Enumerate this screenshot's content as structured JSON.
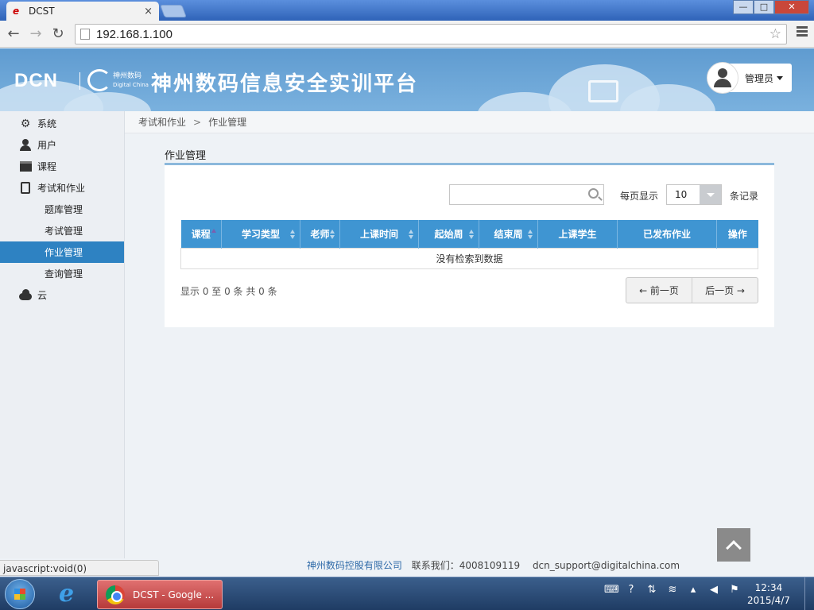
{
  "browser": {
    "tab_title": "DCST",
    "tab_close": "×",
    "url": "192.168.1.100",
    "back": "←",
    "forward": "→",
    "reload": "↻",
    "star": "☆"
  },
  "window_controls": {
    "minimize": "—",
    "maximize": "□",
    "close": "✕"
  },
  "header": {
    "logo_text": "DCN",
    "logo_cn": "神州数码",
    "logo_en": "Digital China",
    "title": "神州数码信息安全实训平台",
    "user_name": "管理员"
  },
  "sidebar": {
    "items": [
      {
        "label": "系统",
        "icon": "gear-icon"
      },
      {
        "label": "用户",
        "icon": "user-icon"
      },
      {
        "label": "课程",
        "icon": "course-icon"
      },
      {
        "label": "考试和作业",
        "icon": "exam-icon"
      },
      {
        "label": "题库管理",
        "sub": true
      },
      {
        "label": "考试管理",
        "sub": true
      },
      {
        "label": "作业管理",
        "sub": true,
        "active": true
      },
      {
        "label": "查询管理",
        "sub": true
      },
      {
        "label": "云",
        "icon": "cloud-icon"
      }
    ]
  },
  "breadcrumb": {
    "parent": "考试和作业",
    "separator": ">",
    "current": "作业管理"
  },
  "panel": {
    "title": "作业管理",
    "search_value": "",
    "per_page_label": "每页显示",
    "per_page_value": "10",
    "records_label": "条记录",
    "columns": [
      "课程",
      "学习类型",
      "老师",
      "上课时间",
      "起始周",
      "结束周",
      "上课学生",
      "已发布作业",
      "操作"
    ],
    "empty_message": "没有检索到数据",
    "info": "显示 0 至 0 条   共 0 条",
    "prev_label": "← 前一页",
    "next_label": "后一页 →"
  },
  "footer": {
    "company": "神州数码控股有限公司",
    "contact": "联系我们：4008109119",
    "email": "dcn_support@digitalchina.com"
  },
  "status_bar": "javascript:void(0)",
  "taskbar": {
    "task_label": "DCST - Google ...",
    "time": "12:34",
    "date": "2015/4/7"
  },
  "colors": {
    "accent": "#2e82c2",
    "table_header": "#3f95d2",
    "header_bg": "#6aa5d6"
  }
}
